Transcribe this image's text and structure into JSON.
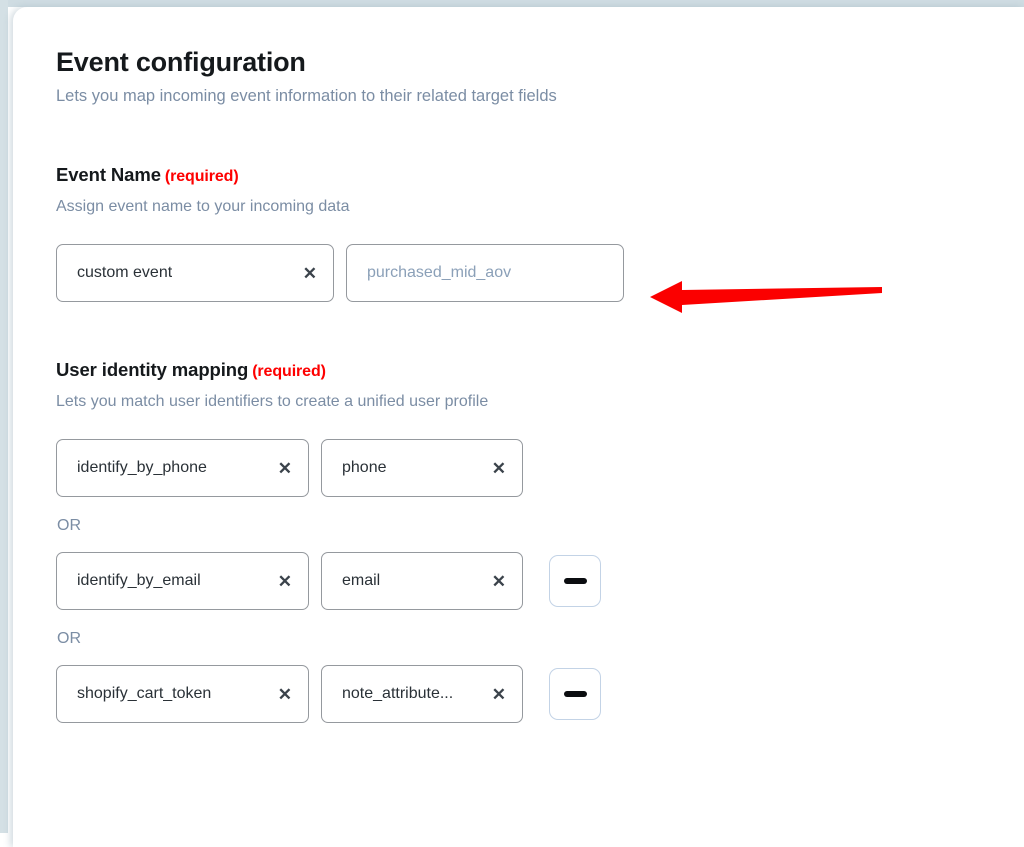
{
  "page": {
    "title": "Event configuration",
    "subtitle": "Lets you map incoming event information to their related target fields"
  },
  "event_name_section": {
    "heading": "Event Name",
    "required_label": "(required)",
    "description": "Assign event name to your incoming data",
    "fields": {
      "type_value": "custom event",
      "type_clear_icon": "close-x-icon",
      "name_value": "purchased_mid_aov",
      "name_is_placeholder": true
    }
  },
  "user_identity_section": {
    "heading": "User identity mapping",
    "required_label": "(required)",
    "description": "Lets you match user identifiers to create a unified user profile",
    "or_label": "OR",
    "remove_icon": "minus-icon",
    "clear_icon": "close-x-icon",
    "rows": [
      {
        "identifier": "identify_by_phone",
        "target": "phone",
        "has_remove": false
      },
      {
        "identifier": "identify_by_email",
        "target": "email",
        "has_remove": true
      },
      {
        "identifier": "shopify_cart_token",
        "target": "note_attribute...",
        "has_remove": true
      }
    ]
  },
  "annotation": {
    "type": "arrow",
    "direction": "left",
    "color": "#fb0000",
    "points_at": "purchased_mid_aov"
  },
  "colors": {
    "accent_required": "#fe0000",
    "muted_text": "#7b8da4",
    "title_text": "#15191c",
    "field_border": "#95999e",
    "remove_border": "#c3d3e6"
  }
}
